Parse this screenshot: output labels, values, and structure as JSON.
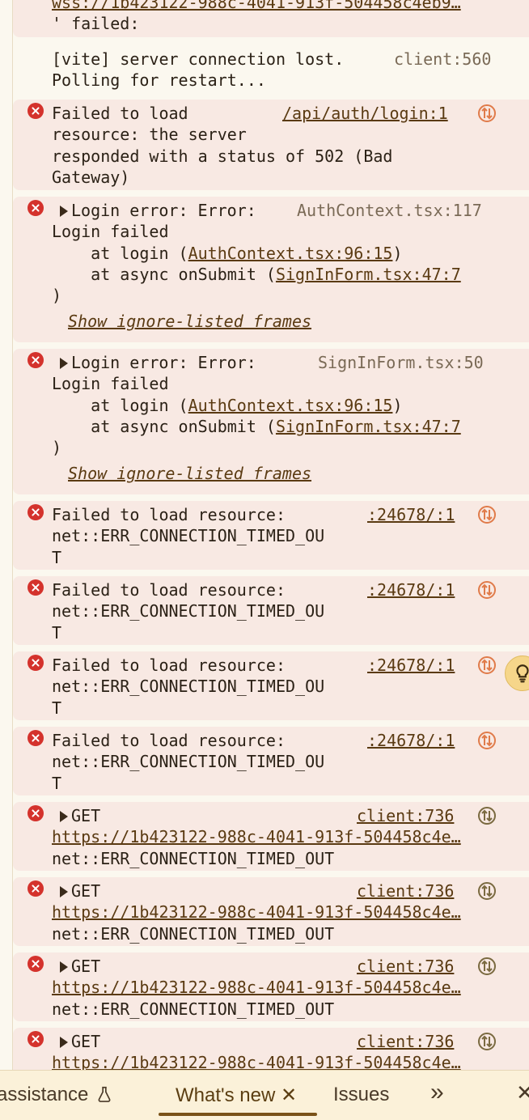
{
  "console": {
    "top_fragment": {
      "line1": "wss://1b423122-988c-4041-913f-504458c4eb9…",
      "line2": "' failed:"
    },
    "vite_message": {
      "line1": "[vite] server connection lost.",
      "source": "client:560",
      "line2": "Polling for restart..."
    },
    "error_502": {
      "line1": "Failed to load",
      "source": "/api/auth/login:1",
      "line2": "resource: the server",
      "line3": "responded with a status of 502 (Bad",
      "line4": "Gateway)"
    },
    "login_error_1": {
      "line1": "Login error: Error:",
      "source": "AuthContext.tsx:117",
      "line2": "Login failed",
      "at1_prefix": "    at login (",
      "at1_link": "AuthContext.tsx:96:15",
      "at1_suffix": ")",
      "at2_prefix": "    at async onSubmit (",
      "at2_link": "SignInForm.tsx:47:7",
      "line5": ")",
      "ignored_link": "Show ignore-listed frames"
    },
    "login_error_2": {
      "line1": "Login error: Error:",
      "source": "SignInForm.tsx:50",
      "line2": "Login failed",
      "at1_prefix": "    at login (",
      "at1_link": "AuthContext.tsx:96:15",
      "at1_suffix": ")",
      "at2_prefix": "    at async onSubmit (",
      "at2_link": "SignInForm.tsx:47:7",
      "line5": ")",
      "ignored_link": "Show ignore-listed frames"
    },
    "timeouts": [
      {
        "line1": "Failed to load resource:",
        "source": ":24678/:1",
        "line2": "net::ERR_CONNECTION_TIMED_OU",
        "line3": "T"
      },
      {
        "line1": "Failed to load resource:",
        "source": ":24678/:1",
        "line2": "net::ERR_CONNECTION_TIMED_OU",
        "line3": "T"
      },
      {
        "line1": "Failed to load resource:",
        "source": ":24678/:1",
        "line2": "net::ERR_CONNECTION_TIMED_OU",
        "line3": "T"
      },
      {
        "line1": "Failed to load resource:",
        "source": ":24678/:1",
        "line2": "net::ERR_CONNECTION_TIMED_OU",
        "line3": "T"
      }
    ],
    "gets": [
      {
        "method": "GET",
        "source": "client:736",
        "url": "https://1b423122-988c-4041-913f-504458c4e…",
        "status": "net::ERR_CONNECTION_TIMED_OUT"
      },
      {
        "method": "GET",
        "source": "client:736",
        "url": "https://1b423122-988c-4041-913f-504458c4e…",
        "status": "net::ERR_CONNECTION_TIMED_OUT"
      },
      {
        "method": "GET",
        "source": "client:736",
        "url": "https://1b423122-988c-4041-913f-504458c4e…",
        "status": "net::ERR_CONNECTION_TIMED_OUT"
      },
      {
        "method": "GET",
        "source": "client:736",
        "url": "https://1b423122-988c-4041-913f-504458c4e…",
        "status": ""
      }
    ]
  },
  "toolbar": {
    "assistance_label": "assistance",
    "whats_new_label": "What's new",
    "close_glyph": "✕",
    "issues_label": "Issues",
    "more_glyph": "»"
  },
  "colors": {
    "error_bg": "#f8e9e3",
    "error_icon": "#d4322c",
    "link": "#5a3a12",
    "network_icon": "#e07b4a",
    "toolbar_bg": "#fbf1d9",
    "assistant_button": "#f6d68a"
  },
  "icons": {
    "error": "error-circle-x-icon",
    "expand": "triangle-right-icon",
    "network": "network-arrows-icon",
    "assistance": "flask-icon",
    "close": "close-icon",
    "more": "chevron-double-right-icon",
    "assistant": "lightbulb-icon"
  }
}
